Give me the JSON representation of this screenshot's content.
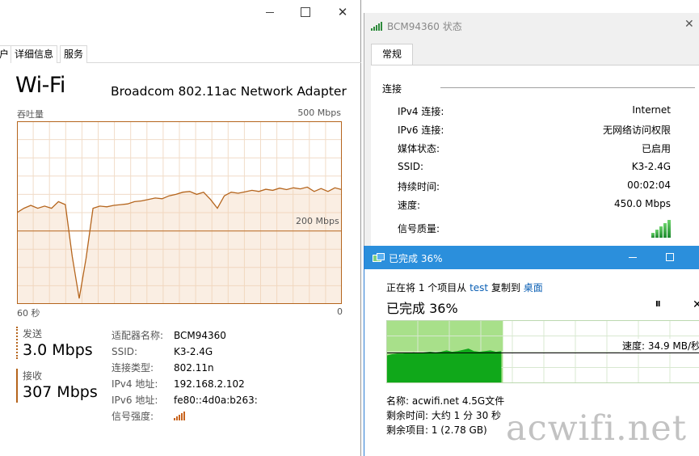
{
  "task_manager": {
    "close_glyph": "✕",
    "tabs": [
      "户",
      "详细信息",
      "服务"
    ],
    "title": "Wi-Fi",
    "adapter": "Broadcom 802.11ac Network Adapter",
    "throughput_label": "吞吐量",
    "scale_max": "500 Mbps",
    "scale_mid": "200 Mbps",
    "time_left": "60 秒",
    "time_right": "0",
    "graph_color": "#b5651d",
    "throughput_series_mbps": [
      250,
      262,
      270,
      262,
      268,
      262,
      280,
      272,
      130,
      15,
      125,
      262,
      268,
      266,
      270,
      272,
      274,
      280,
      282,
      286,
      290,
      288,
      296,
      300,
      306,
      308,
      300,
      306,
      286,
      262,
      296,
      306,
      303,
      307,
      311,
      308,
      314,
      311,
      317,
      313,
      318,
      315,
      320,
      308,
      316,
      308,
      318,
      313
    ],
    "send": {
      "label": "发送",
      "value": "3.0 Mbps"
    },
    "recv": {
      "label": "接收",
      "value": "307 Mbps"
    },
    "details": [
      {
        "k": "适配器名称:",
        "v": "BCM94360"
      },
      {
        "k": "SSID:",
        "v": "K3-2.4G"
      },
      {
        "k": "连接类型:",
        "v": "802.11n"
      },
      {
        "k": "IPv4 地址:",
        "v": "192.168.2.102"
      },
      {
        "k": "IPv6 地址:",
        "v": "fe80::4d0a:b263:"
      },
      {
        "k": "信号强度:",
        "v": ""
      }
    ]
  },
  "status_dialog": {
    "title": "BCM94360 状态",
    "close_glyph": "✕",
    "tab": "常规",
    "section": "连接",
    "rows": [
      {
        "k": "IPv4 连接:",
        "v": "Internet"
      },
      {
        "k": "IPv6 连接:",
        "v": "无网络访问权限"
      },
      {
        "k": "媒体状态:",
        "v": "已启用"
      },
      {
        "k": "SSID:",
        "v": "K3-2.4G"
      },
      {
        "k": "持续时间:",
        "v": "00:02:04"
      },
      {
        "k": "速度:",
        "v": "450.0 Mbps"
      },
      {
        "k": "信号质量:",
        "v": ""
      }
    ]
  },
  "copy_dialog": {
    "title": "已完成 36%",
    "line_prefix": "正在将 1 个项目从 ",
    "source": "test",
    "line_mid": " 复制到 ",
    "dest": "桌面",
    "percent_text": "已完成 36%",
    "progress": 0.36,
    "pause_glyph": "II",
    "stop_glyph": "✕",
    "speed": "速度: 34.9 MB/秒",
    "info": [
      "名称: acwifi.net 4.5G文件",
      "剩余时间: 大约 1 分 30 秒",
      "剩余项目: 1 (2.78 GB)"
    ],
    "accent": "#2b8fdc"
  },
  "watermark": "acwifi.net"
}
